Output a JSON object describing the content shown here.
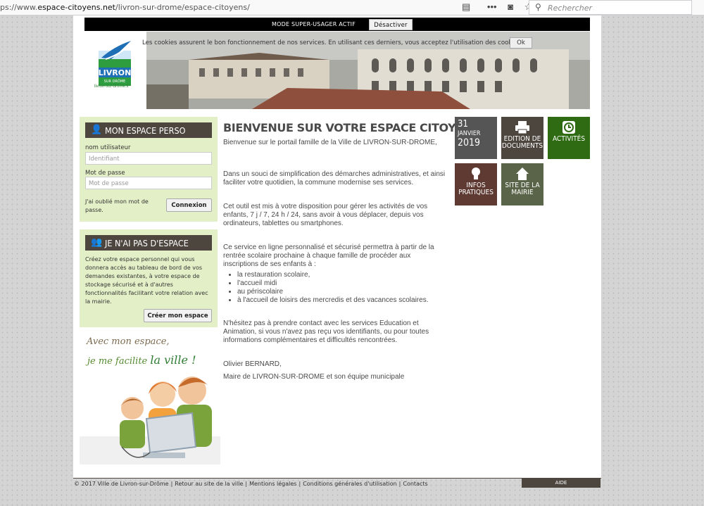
{
  "browser": {
    "url_prefix": "ps://www.",
    "url_domain": "espace-citoyens.net",
    "url_path": "/livron-sur-drome/espace-citoyens/",
    "search_placeholder": "Rechercher",
    "icons": [
      "reader-icon",
      "more-icon",
      "pocket-icon",
      "bookmark-star-icon"
    ]
  },
  "superbar": {
    "label": "MODE SUPER-USAGER ACTIF",
    "button": "Désactiver"
  },
  "cookie": {
    "text": "Les cookies assurent le bon fonctionnement de nos services. En utilisant ces derniers, vous acceptez l'utilisation des cookies.",
    "ok": "Ok"
  },
  "logo": {
    "name": "LIVRON",
    "sub": "SUR DRÔME",
    "url": "livron-sur-drome.fr"
  },
  "login": {
    "title": "MON ESPACE PERSO",
    "user_label": "nom utilisateur",
    "user_placeholder": "Identifiant",
    "pass_label": "Mot de passe",
    "pass_placeholder": "Mot de passe",
    "forgot": "J'ai oublié mon mot de passe.",
    "submit": "Connexion"
  },
  "register": {
    "title": "JE N'AI PAS D'ESPACE",
    "text": "Créez votre espace personnel qui vous donnera accès au tableau de bord de vos demandes existantes, à votre espace de stockage sécurisé et à d'autres fonctionnalités facilitant votre relation avec la mairie.",
    "button": "Créer mon espace"
  },
  "slogan": {
    "line1": "Avec mon espace,",
    "line2a": "je me facilite",
    "line2b": "la ville !"
  },
  "main": {
    "title": "BIENVENUE SUR VOTRE ESPACE CITOYENS",
    "p1": "Bienvenue sur le portail famille de la Ville de LIVRON-SUR-DROME,",
    "p2": "Dans un souci de simplification des démarches administratives, et ainsi faciliter votre quotidien, la commune modernise ses services.",
    "p3": "Cet outil est mis à votre disposition pour gérer les activités de vos enfants, 7 j / 7, 24 h / 24, sans avoir à vous déplacer, depuis vos ordinateurs, tablettes ou smartphones.",
    "p4": "Ce service en ligne personnalisé et sécurisé permettra à partir de la rentrée scolaire prochaine à chaque famille de procéder aux inscriptions de ses enfants à :",
    "list": [
      "la restauration scolaire,",
      "l'accueil midi",
      "au périscolaire",
      "à l'accueil de loisirs des mercredis et des vacances scolaires."
    ],
    "p5": "N'hésitez pas à prendre contact avec les services Education et Animation, si vous n'avez pas reçu vos identifiants, ou pour toutes informations complémentaires et difficultés rencontrées.",
    "sign1": "Olivier BERNARD,",
    "sign2": "Maire de LIVRON-SUR-DROME et son équipe municipale"
  },
  "tiles": {
    "date_day": "31",
    "date_month": "JANVIER",
    "date_year": "2019",
    "edition": "EDITION DE DOCUMENTS",
    "activites": "ACTIVITÉS",
    "infos": "INFOS PRATIQUES",
    "mairie": "SITE DE LA MAIRIE"
  },
  "colors": {
    "tile_grey": "#555555",
    "tile_dark": "#4d463f",
    "tile_green": "#2e6b12",
    "tile_brown": "#5e3a33",
    "tile_olive": "#5a6448",
    "box_bg": "#e3efc7"
  },
  "footer": {
    "copyright": "© 2017 Ville de Livron-sur-Drôme",
    "links": [
      "Retour au site de la ville",
      "Mentions légales",
      "Conditions générales d'utilisation",
      "Contacts"
    ],
    "aide": "AIDE"
  }
}
